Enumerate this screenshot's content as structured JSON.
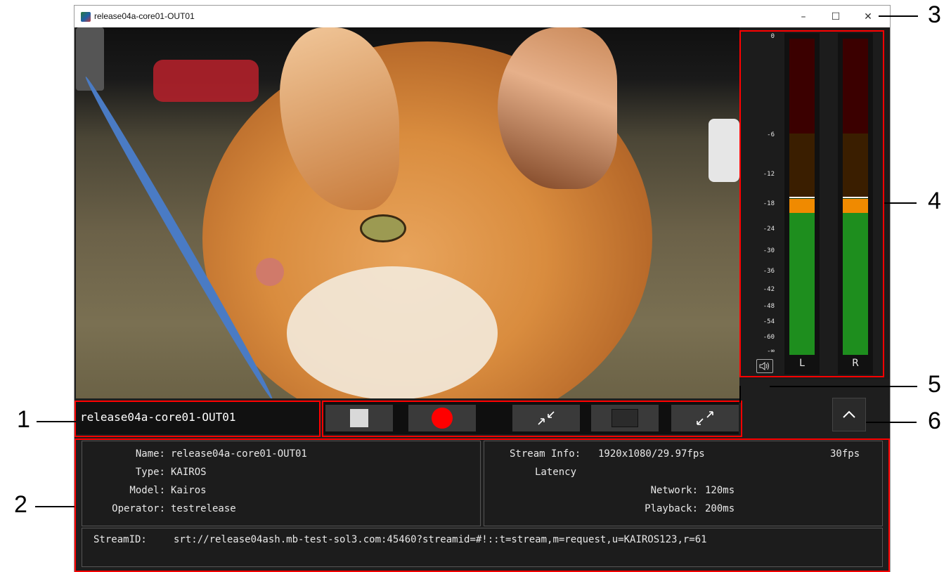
{
  "window": {
    "title": "release04a-core01-OUT01",
    "controls": {
      "minimize": "–",
      "maximize": "☐",
      "close": "✕"
    }
  },
  "meter": {
    "scale": [
      "0",
      "-6",
      "-12",
      "-18",
      "-24",
      "-30",
      "-36",
      "-42",
      "-48",
      "-54",
      "-60",
      "-∞"
    ],
    "channels": [
      {
        "label": "L",
        "level_db": -19
      },
      {
        "label": "R",
        "level_db": -19
      }
    ],
    "colors": {
      "red": "#3b0000",
      "amber": "#3a1e00",
      "green": "#1e8e1e",
      "orange": "#f08a00"
    }
  },
  "control_row": {
    "source_name": "release04a-core01-OUT01",
    "buttons": [
      "stop-icon",
      "record-icon",
      "shrink-icon",
      "window-icon",
      "expand-icon"
    ],
    "up_label": "^"
  },
  "info": {
    "name_label": "Name:",
    "name_value": "release04a-core01-OUT01",
    "type_label": "Type:",
    "type_value": "KAIROS",
    "model_label": "Model:",
    "model_value": "Kairos",
    "operator_label": "Operator:",
    "operator_value": "testrelease",
    "stream_info_label": "Stream Info:",
    "stream_info_value": "1920x1080/29.97fps",
    "fps": "30fps",
    "latency_label": "Latency",
    "network_label": "Network:",
    "network_value": "120ms",
    "playback_label": "Playback:",
    "playback_value": "200ms",
    "streamid_label": "StreamID:",
    "streamid_value": "srt://release04ash.mb-test-sol3.com:45460?streamid=#!::t=stream,m=request,u=KAIROS123,r=61"
  },
  "callouts": [
    "1",
    "2",
    "3",
    "4",
    "5",
    "6"
  ]
}
